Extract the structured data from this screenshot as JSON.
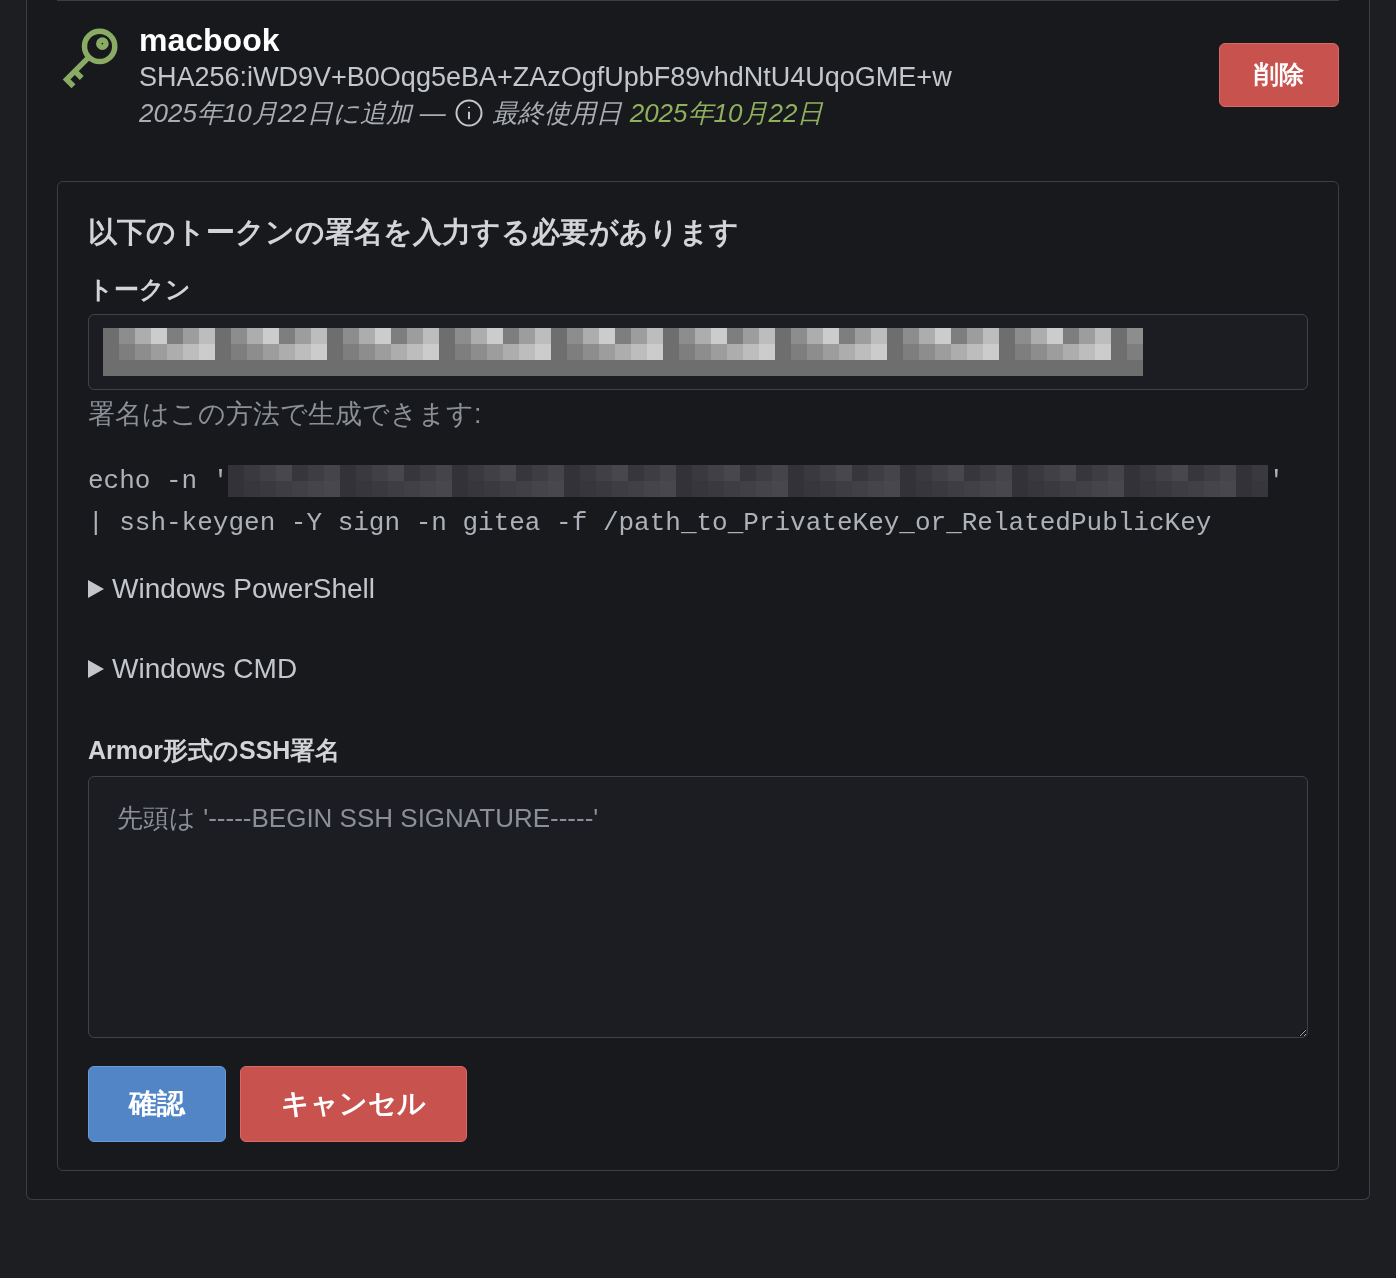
{
  "key": {
    "name": "macbook",
    "fingerprint": "SHA256:iWD9V+B0Oqg5eBA+ZAzOgfUpbF89vhdNtU4UqoGME+w",
    "added": "2025年10月22日に追加",
    "separator": "—",
    "last_used_label": "最終使用日",
    "last_used_date": "2025年10月22日"
  },
  "delete_button": "削除",
  "verify": {
    "title": "以下のトークンの署名を入力する必要があります",
    "token_label": "トークン",
    "hint": "署名はこの方法で生成できます:",
    "command": {
      "line_1_start": "echo -n '",
      "line_1_end": "'",
      "line_2": "| ssh-keygen -Y sign -n gitea -f /path_to_PrivateKey_or_RelatedPublicKey"
    },
    "details": [
      {
        "label": "Windows PowerShell",
        "expanded": false
      },
      {
        "label": "Windows CMD",
        "expanded": false
      }
    ],
    "signature_label": "Armor形式のSSH署名",
    "signature_placeholder": "先頭は '-----BEGIN SSH SIGNATURE-----'",
    "buttons": [
      {
        "label": "確認",
        "kind": "primary"
      },
      {
        "label": "キャンセル",
        "kind": "danger"
      }
    ]
  }
}
